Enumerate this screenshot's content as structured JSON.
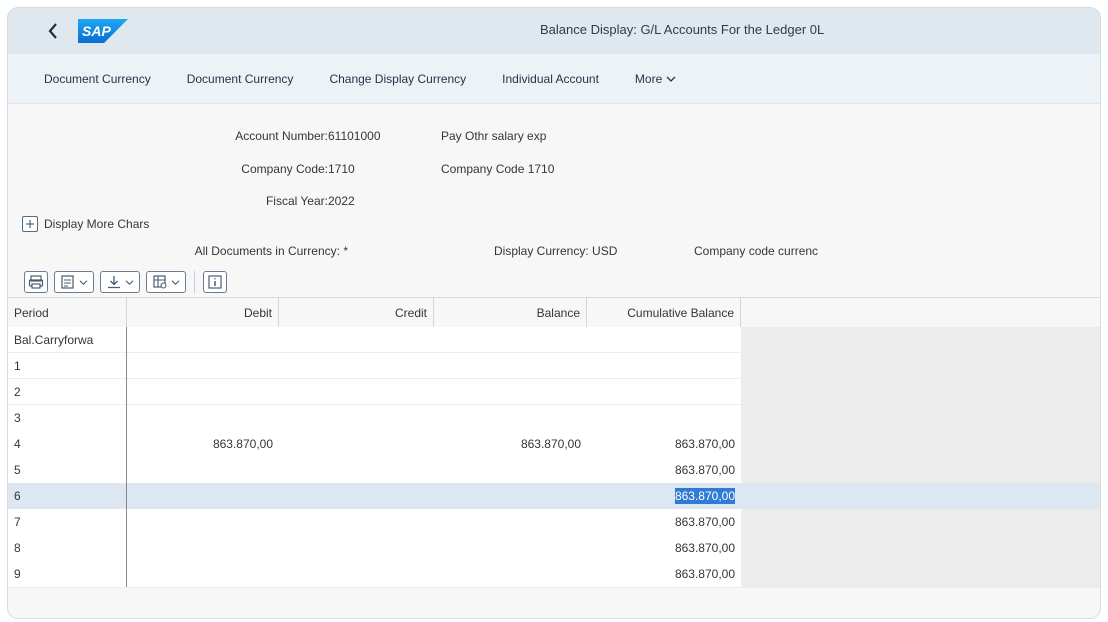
{
  "shell": {
    "back_label": "<",
    "logo_text": "SAP",
    "title": "Balance Display: G/L Accounts For the Ledger 0L"
  },
  "toolbar": {
    "items": [
      "Document Currency",
      "Document Currency",
      "Change Display Currency",
      "Individual Account"
    ],
    "more_label": "More"
  },
  "header": {
    "account_number_label": "Account Number:",
    "account_number_value": "61101000",
    "account_desc": "Pay Othr salary exp",
    "company_code_label": "Company Code:",
    "company_code_value": "1710",
    "company_code_desc": "Company Code 1710",
    "fiscal_year_label": "Fiscal Year:",
    "fiscal_year_value": "2022",
    "display_more_label": "Display More Chars",
    "all_docs_label": "All Documents in Currency:",
    "all_docs_value": "*",
    "display_currency_label": "Display Currency:",
    "display_currency_value": "USD",
    "company_code_currency_label": "Company code currenc"
  },
  "grid_toolbar": {
    "icons": [
      "print-icon",
      "layout-icon",
      "export-icon",
      "view-icon",
      "info-icon"
    ]
  },
  "table": {
    "columns": [
      "Period",
      "Debit",
      "Credit",
      "Balance",
      "Cumulative Balance"
    ],
    "rows": [
      {
        "period": "Bal.Carryforwa",
        "debit": "",
        "credit": "",
        "balance": "",
        "cumulative": ""
      },
      {
        "period": "1",
        "debit": "",
        "credit": "",
        "balance": "",
        "cumulative": ""
      },
      {
        "period": "2",
        "debit": "",
        "credit": "",
        "balance": "",
        "cumulative": ""
      },
      {
        "period": "3",
        "debit": "",
        "credit": "",
        "balance": "",
        "cumulative": ""
      },
      {
        "period": "4",
        "debit": "863.870,00",
        "credit": "",
        "balance": "863.870,00",
        "cumulative": "863.870,00"
      },
      {
        "period": "5",
        "debit": "",
        "credit": "",
        "balance": "",
        "cumulative": "863.870,00"
      },
      {
        "period": "6",
        "debit": "",
        "credit": "",
        "balance": "",
        "cumulative": "863.870,00",
        "selected": true
      },
      {
        "period": "7",
        "debit": "",
        "credit": "",
        "balance": "",
        "cumulative": "863.870,00"
      },
      {
        "period": "8",
        "debit": "",
        "credit": "",
        "balance": "",
        "cumulative": "863.870,00"
      },
      {
        "period": "9",
        "debit": "",
        "credit": "",
        "balance": "",
        "cumulative": "863.870,00"
      }
    ]
  },
  "colors": {
    "shell_bg": "#dfe7ef",
    "toolbar_bg": "#edf2f6",
    "selection_row": "#dce7f1",
    "selection_cell": "#2f7bd6",
    "sap_blue": "#0a6ed1"
  }
}
